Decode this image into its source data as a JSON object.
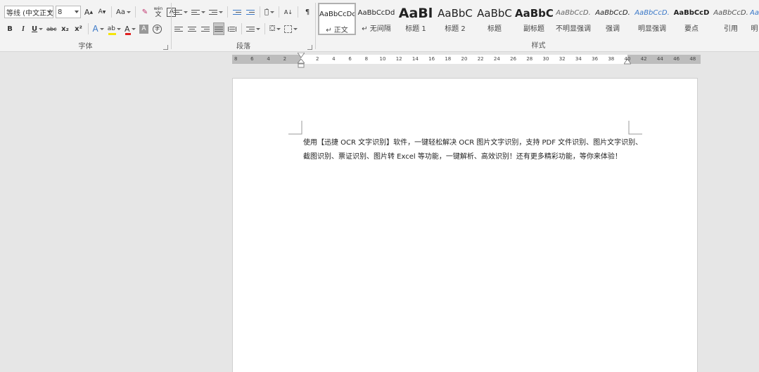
{
  "font_group": {
    "label": "字体",
    "font_name": "等线 (中文正文",
    "font_size": "8",
    "grow_font": "A",
    "shrink_font": "A",
    "change_case": "Aa",
    "clear_format": "✎",
    "phonetic_guide": "wén",
    "char_border": "A",
    "bold": "B",
    "italic": "I",
    "underline": "U",
    "strikethrough": "abc",
    "subscript": "x₂",
    "superscript": "x²",
    "text_effects": "A",
    "highlight": "ab",
    "font_color": "A",
    "char_shading": "A",
    "enclose_char": "字",
    "highlight_color": "#f5e50a",
    "font_color_value": "#e02020"
  },
  "paragraph_group": {
    "label": "段落",
    "sort": "A↓",
    "show_marks": "¶"
  },
  "styles_group": {
    "label": "样式",
    "items": [
      {
        "sample": "AaBbCcDd",
        "name": "↵ 正文"
      },
      {
        "sample": "AaBbCcDd",
        "name": "↵ 无间隔"
      },
      {
        "sample": "AaBl",
        "name": "标题 1"
      },
      {
        "sample": "AaBbC",
        "name": "标题 2"
      },
      {
        "sample": "AaBbC",
        "name": "标题"
      },
      {
        "sample": "AaBbC",
        "name": "副标题"
      },
      {
        "sample": "AaBbCcD.",
        "name": "不明显强调"
      },
      {
        "sample": "AaBbCcD.",
        "name": "强调"
      },
      {
        "sample": "AaBbCcD.",
        "name": "明显强调"
      },
      {
        "sample": "AaBbCcD",
        "name": "要点"
      },
      {
        "sample": "AaBbCcD.",
        "name": "引用"
      },
      {
        "sample": "Aa",
        "name": "明"
      }
    ]
  },
  "ruler": {
    "numbers": [
      "8",
      "6",
      "4",
      "2",
      "2",
      "4",
      "6",
      "8",
      "10",
      "12",
      "14",
      "16",
      "18",
      "20",
      "22",
      "24",
      "26",
      "28",
      "30",
      "32",
      "34",
      "36",
      "38",
      "40",
      "42",
      "44",
      "46",
      "48"
    ]
  },
  "document": {
    "paragraph": "使用【迅捷 OCR 文字识别】软件，一键轻松解决 OCR 图片文字识别，支持 PDF 文件识别、图片文字识别、截图识别、票证识别、图片转 Excel 等功能，一键解析、高效识别！还有更多精彩功能，等你来体验！"
  }
}
